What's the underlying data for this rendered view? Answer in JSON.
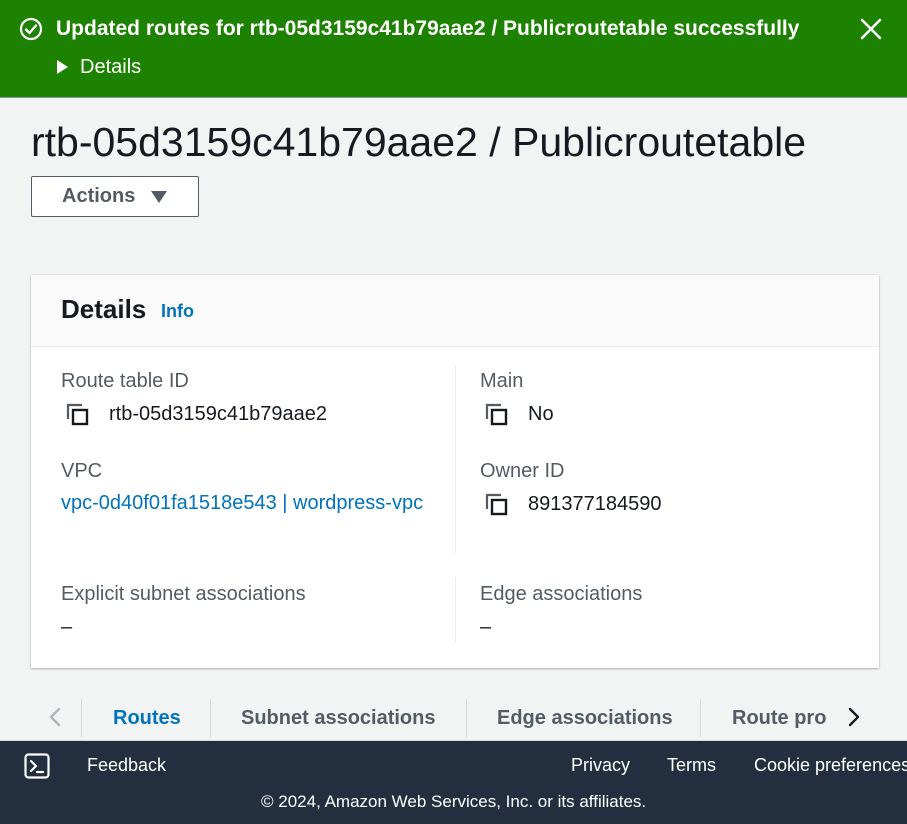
{
  "flash": {
    "message": "Updated routes for rtb-05d3159c41b79aae2 / Publicroutetable successfully",
    "details_label": "Details",
    "status_color": "#1d8102"
  },
  "page": {
    "title": "rtb-05d3159c41b79aae2 / Publicroutetable",
    "actions_label": "Actions"
  },
  "details": {
    "title": "Details",
    "info_label": "Info",
    "route_table_id": {
      "label": "Route table ID",
      "value": "rtb-05d3159c41b79aae2"
    },
    "main": {
      "label": "Main",
      "value": "No"
    },
    "vpc": {
      "label": "VPC",
      "value": "vpc-0d40f01fa1518e543 | wordpress-vpc"
    },
    "owner_id": {
      "label": "Owner ID",
      "value": "891377184590"
    },
    "explicit_subnet": {
      "label": "Explicit subnet associations",
      "value": "–"
    },
    "edge": {
      "label": "Edge associations",
      "value": "–"
    }
  },
  "tabs": [
    {
      "label": "Routes",
      "active": true
    },
    {
      "label": "Subnet associations",
      "active": false
    },
    {
      "label": "Edge associations",
      "active": false
    },
    {
      "label": "Route propagation",
      "active": false
    }
  ],
  "footer": {
    "feedback": "Feedback",
    "privacy": "Privacy",
    "terms": "Terms",
    "cookie": "Cookie preferences",
    "copyright": "© 2024, Amazon Web Services, Inc. or its affiliates."
  },
  "colors": {
    "link": "#0073bb",
    "footer_bg": "#232f3e"
  }
}
